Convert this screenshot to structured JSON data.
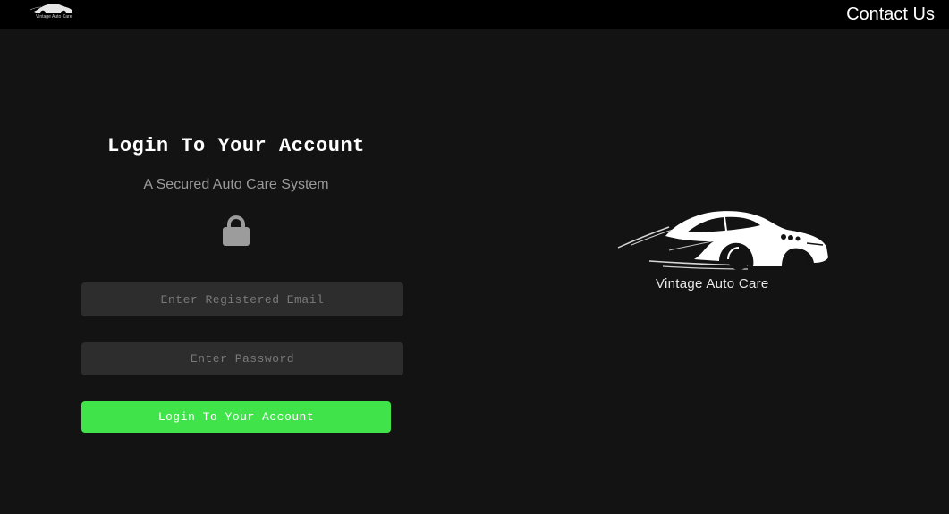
{
  "header": {
    "logo_text": "Vintage Auto Care",
    "contact_label": "Contact Us"
  },
  "login": {
    "title": "Login To Your Account",
    "subtitle": "A Secured Auto Care System",
    "lock_icon": "lock-icon",
    "email_placeholder": "Enter Registered Email",
    "email_value": "",
    "password_placeholder": "Enter Password",
    "password_value": "",
    "submit_label": "Login To Your Account"
  },
  "brand": {
    "name": "Vintage Auto Care",
    "icon": "car-logo-icon"
  },
  "colors": {
    "background": "#131313",
    "topbar": "#000000",
    "field": "#2e2d2e",
    "accent": "#40e349"
  }
}
